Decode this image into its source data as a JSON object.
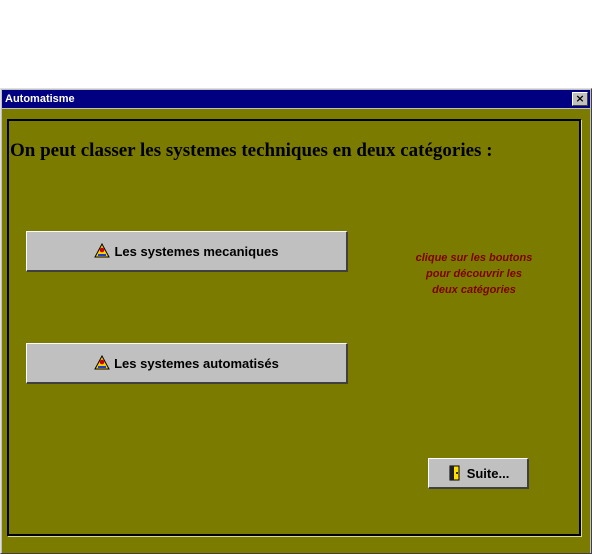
{
  "window": {
    "title": "Automatisme",
    "close_label": "×"
  },
  "main": {
    "heading": "On peut classer les systemes techniques en deux catégories :",
    "buttons": [
      {
        "label": "Les systemes mecaniques",
        "icon": "info-icon"
      },
      {
        "label": "Les systemes automatisés",
        "icon": "info-icon"
      }
    ],
    "hint_lines": [
      "clique sur les boutons",
      "pour découvrir les",
      "deux catégories"
    ],
    "next_button": {
      "label": "Suite...",
      "icon": "door-icon"
    }
  },
  "colors": {
    "title_bar": "#000080",
    "client_bg": "#7b7b00",
    "button_face": "#c0c0c0",
    "hint_text": "#800000"
  }
}
